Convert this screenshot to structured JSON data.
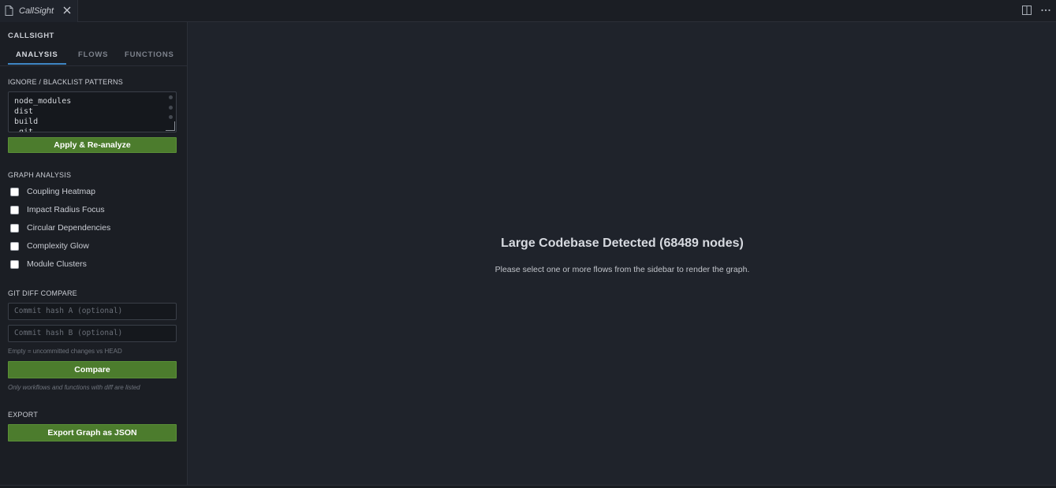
{
  "tab": {
    "title": "CallSight",
    "file_icon": "file-icon",
    "close_icon": "close-icon"
  },
  "header_actions": {
    "split": "split-editor-icon",
    "more": "more-icon"
  },
  "sidebar": {
    "app_title": "CALLSIGHT",
    "tabs": [
      {
        "label": "ANALYSIS",
        "active": true
      },
      {
        "label": "FLOWS",
        "active": false
      },
      {
        "label": "FUNCTIONS",
        "active": false
      }
    ],
    "ignore": {
      "heading": "IGNORE / BLACKLIST PATTERNS",
      "patterns": "node_modules\ndist\nbuild\n.git",
      "apply_label": "Apply & Re-analyze"
    },
    "graph_analysis": {
      "heading": "GRAPH ANALYSIS",
      "options": [
        {
          "label": "Coupling Heatmap",
          "checked": false
        },
        {
          "label": "Impact Radius Focus",
          "checked": false
        },
        {
          "label": "Circular Dependencies",
          "checked": false
        },
        {
          "label": "Complexity Glow",
          "checked": false
        },
        {
          "label": "Module Clusters",
          "checked": false
        }
      ]
    },
    "git_diff": {
      "heading": "GIT DIFF COMPARE",
      "hash_a_placeholder": "Commit hash A (optional)",
      "hash_b_placeholder": "Commit hash B (optional)",
      "hint": "Empty = uncommitted changes vs HEAD",
      "compare_label": "Compare",
      "note": "Only workflows and functions with diff are listed"
    },
    "export": {
      "heading": "EXPORT",
      "button_label": "Export Graph as JSON"
    }
  },
  "main": {
    "title": "Large Codebase Detected (68489 nodes)",
    "subtitle": "Please select one or more flows from the sidebar to render the graph."
  },
  "colors": {
    "accent_green": "#4c7c2d",
    "tab_underline": "#3f86c4",
    "background": "#1f232b"
  }
}
